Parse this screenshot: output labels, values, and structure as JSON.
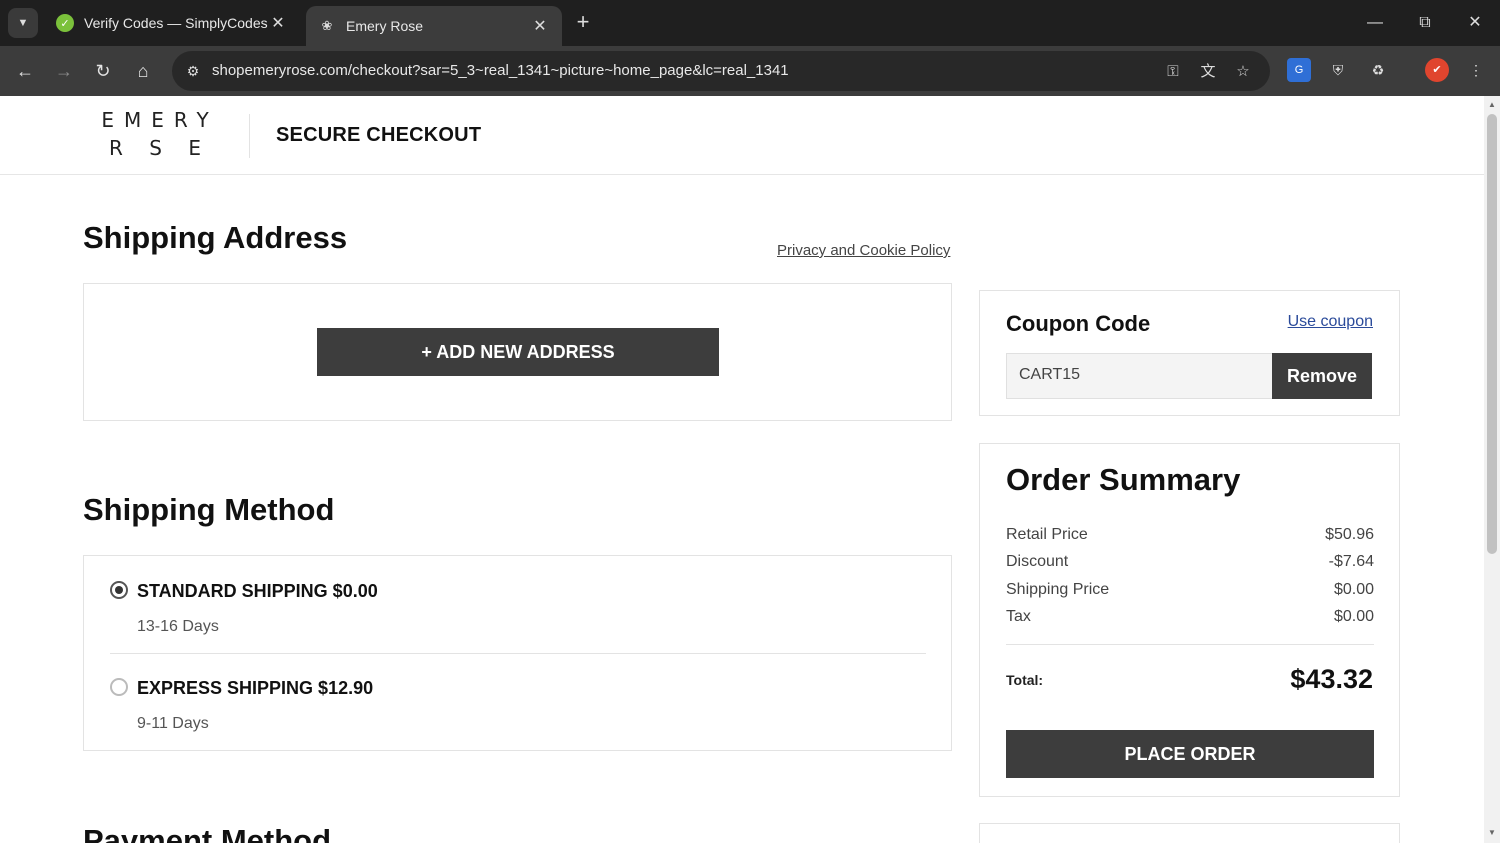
{
  "browser": {
    "tabs": [
      {
        "title": "Verify Codes — SimplyCodes",
        "active": false
      },
      {
        "title": "Emery Rose",
        "active": true
      }
    ],
    "url": "shopemeryrose.com/checkout?sar=5_3~real_1341~picture~home_page&lc=real_1341"
  },
  "header": {
    "logo_line1": "EMERY",
    "logo_line2": "R S E",
    "title": "SECURE CHECKOUT"
  },
  "shipping_address": {
    "heading": "Shipping Address",
    "privacy_link": "Privacy and Cookie Policy",
    "add_button": "+ ADD NEW ADDRESS"
  },
  "shipping_method": {
    "heading": "Shipping Method",
    "options": [
      {
        "label": "STANDARD SHIPPING $0.00",
        "days": "13-16 Days",
        "selected": true
      },
      {
        "label": "EXPRESS SHIPPING $12.90",
        "days": "9-11 Days",
        "selected": false
      }
    ]
  },
  "payment_method": {
    "heading": "Payment Method"
  },
  "coupon": {
    "title": "Coupon Code",
    "use_link": "Use coupon",
    "value": "CART15",
    "remove_button": "Remove"
  },
  "order_summary": {
    "title": "Order Summary",
    "rows": [
      {
        "label": "Retail Price",
        "value": "$50.96"
      },
      {
        "label": "Discount",
        "value": "-$7.64"
      },
      {
        "label": "Shipping Price",
        "value": "$0.00"
      },
      {
        "label": "Tax",
        "value": "$0.00"
      }
    ],
    "total_label": "Total:",
    "total_value": "$43.32",
    "place_order": "PLACE ORDER"
  },
  "colors": {
    "chrome_bg": "#1f1f1f",
    "toolbar_bg": "#3c3c3c",
    "button_dark": "#3d3d3d",
    "link_blue": "#2a4a9a"
  }
}
